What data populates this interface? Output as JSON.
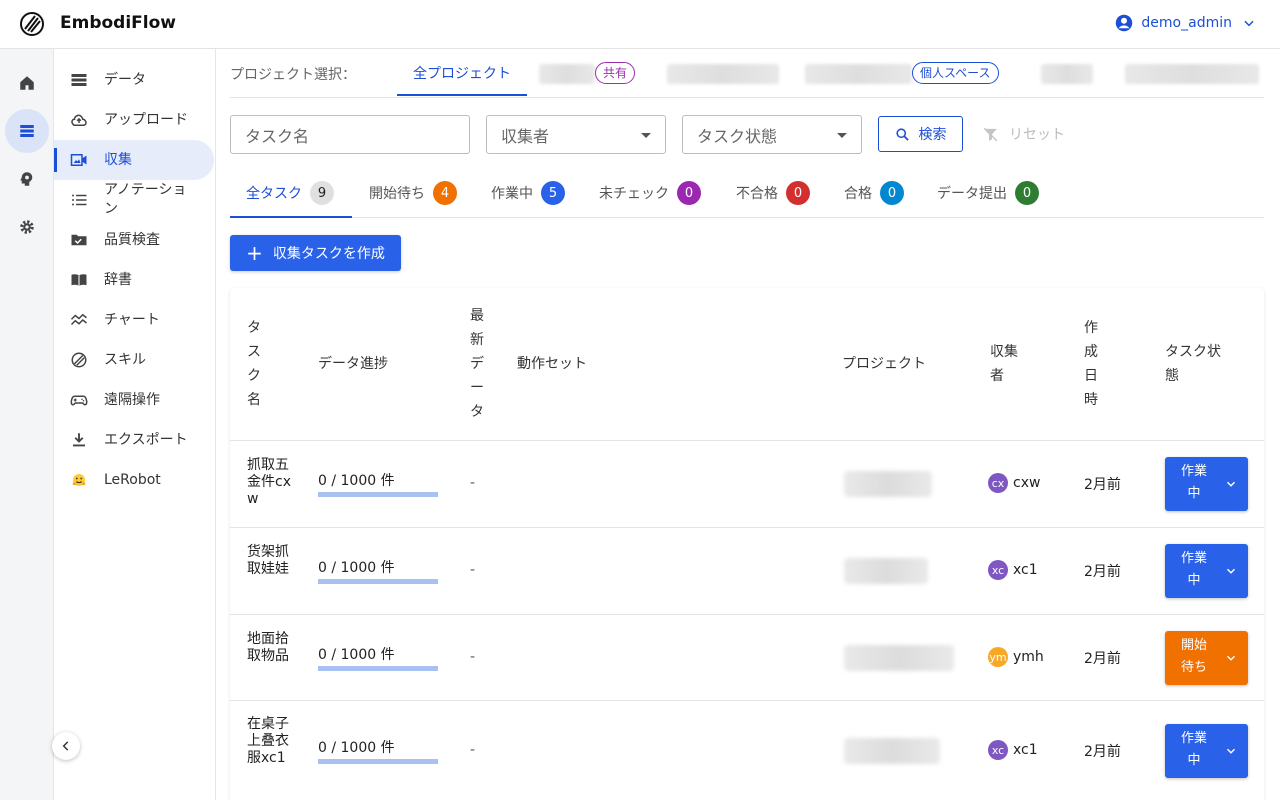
{
  "app": {
    "name": "EmbodiFlow"
  },
  "user": {
    "name": "demo_admin"
  },
  "colors": {
    "primary": "#1d4fd6",
    "orange": "#f07000",
    "purple": "#9c27b0",
    "red": "#d32f2f",
    "teal": "#0288d1",
    "green": "#2e7d32",
    "gray": "#e0e0e0"
  },
  "rail": {
    "items": [
      {
        "icon": "home-icon"
      },
      {
        "icon": "database-icon"
      },
      {
        "icon": "brain-icon"
      },
      {
        "icon": "gear-icon"
      }
    ]
  },
  "sidebar": {
    "items": [
      {
        "label": "データ",
        "icon": "storage-icon"
      },
      {
        "label": "アップロード",
        "icon": "cloud-upload-icon"
      },
      {
        "label": "収集",
        "icon": "video-icon"
      },
      {
        "label": "アノテーション",
        "icon": "list-icon"
      },
      {
        "label": "品質検査",
        "icon": "folder-check-icon"
      },
      {
        "label": "辞書",
        "icon": "book-icon"
      },
      {
        "label": "チャート",
        "icon": "chart-icon"
      },
      {
        "label": "スキル",
        "icon": "skill-icon"
      },
      {
        "label": "遠隔操作",
        "icon": "gamepad-icon"
      },
      {
        "label": "エクスポート",
        "icon": "download-icon"
      },
      {
        "label": "LeRobot",
        "icon": "hugging-face-icon"
      }
    ]
  },
  "project": {
    "label": "プロジェクト選択：",
    "all_label": "全プロジェクト",
    "tag_shared": "共有",
    "tag_personal": "個人スペース"
  },
  "filters": {
    "task_name_placeholder": "タスク名",
    "collector_placeholder": "収集者",
    "status_placeholder": "タスク状態",
    "search_label": "検索",
    "reset_label": "リセット"
  },
  "status_tabs": [
    {
      "label": "全タスク",
      "count": "9"
    },
    {
      "label": "開始待ち",
      "count": "4"
    },
    {
      "label": "作業中",
      "count": "5"
    },
    {
      "label": "未チェック",
      "count": "0"
    },
    {
      "label": "不合格",
      "count": "0"
    },
    {
      "label": "合格",
      "count": "0"
    },
    {
      "label": "データ提出",
      "count": "0"
    }
  ],
  "create_button": "収集タスクを作成",
  "table": {
    "headers": {
      "task_name": "タスク名",
      "progress": "データ進捗",
      "latest_data": "最新データ",
      "action_set": "動作セット",
      "project": "プロジェクト",
      "collector": "収集者",
      "created": "作成日時",
      "status": "タスク状態"
    },
    "rows": [
      {
        "name": "抓取五金件cxw",
        "progress_text": "0 / 1000 件",
        "progress": 0,
        "latest": "-",
        "collector_initials": "cx",
        "collector": "cxw",
        "collector_color": "#7e57c2",
        "created": "2月前",
        "status": "作業中",
        "status_color": "#2962e8"
      },
      {
        "name": "货架抓取娃娃",
        "progress_text": "0 / 1000 件",
        "progress": 0,
        "latest": "-",
        "collector_initials": "xc",
        "collector": "xc1",
        "collector_color": "#7e57c2",
        "created": "2月前",
        "status": "作業中",
        "status_color": "#2962e8"
      },
      {
        "name": "地面拾取物品",
        "progress_text": "0 / 1000 件",
        "progress": 0,
        "latest": "-",
        "collector_initials": "ym",
        "collector": "ymh",
        "collector_color": "#f9a825",
        "created": "2月前",
        "status": "開始待ち",
        "status_color": "#f07000"
      },
      {
        "name": "在桌子上叠衣服xc1",
        "progress_text": "0 / 1000 件",
        "progress": 0,
        "latest": "-",
        "collector_initials": "xc",
        "collector": "xc1",
        "collector_color": "#7e57c2",
        "created": "2月前",
        "status": "作業中",
        "status_color": "#2962e8"
      }
    ]
  }
}
